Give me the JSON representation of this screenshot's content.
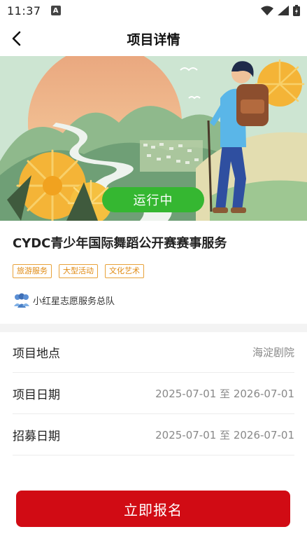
{
  "status_bar": {
    "time": "11:37",
    "notif_letter": "A"
  },
  "nav": {
    "title": "项目详情"
  },
  "banner": {
    "status": "运行中"
  },
  "project": {
    "title": "CYDC青少年国际舞蹈公开赛赛事服务",
    "tags": [
      "旅游服务",
      "大型活动",
      "文化艺术"
    ],
    "organization": "小红星志愿服务总队"
  },
  "details": [
    {
      "label": "项目地点",
      "value": "海淀剧院"
    },
    {
      "label": "项目日期",
      "value": "2025-07-01 至 2026-07-01"
    },
    {
      "label": "招募日期",
      "value": "2025-07-01 至 2026-07-01"
    }
  ],
  "cta": {
    "label": "立即报名"
  },
  "colors": {
    "brand_red": "#d10b14",
    "status_green": "#35b731",
    "tag_orange": "#e08a12"
  }
}
